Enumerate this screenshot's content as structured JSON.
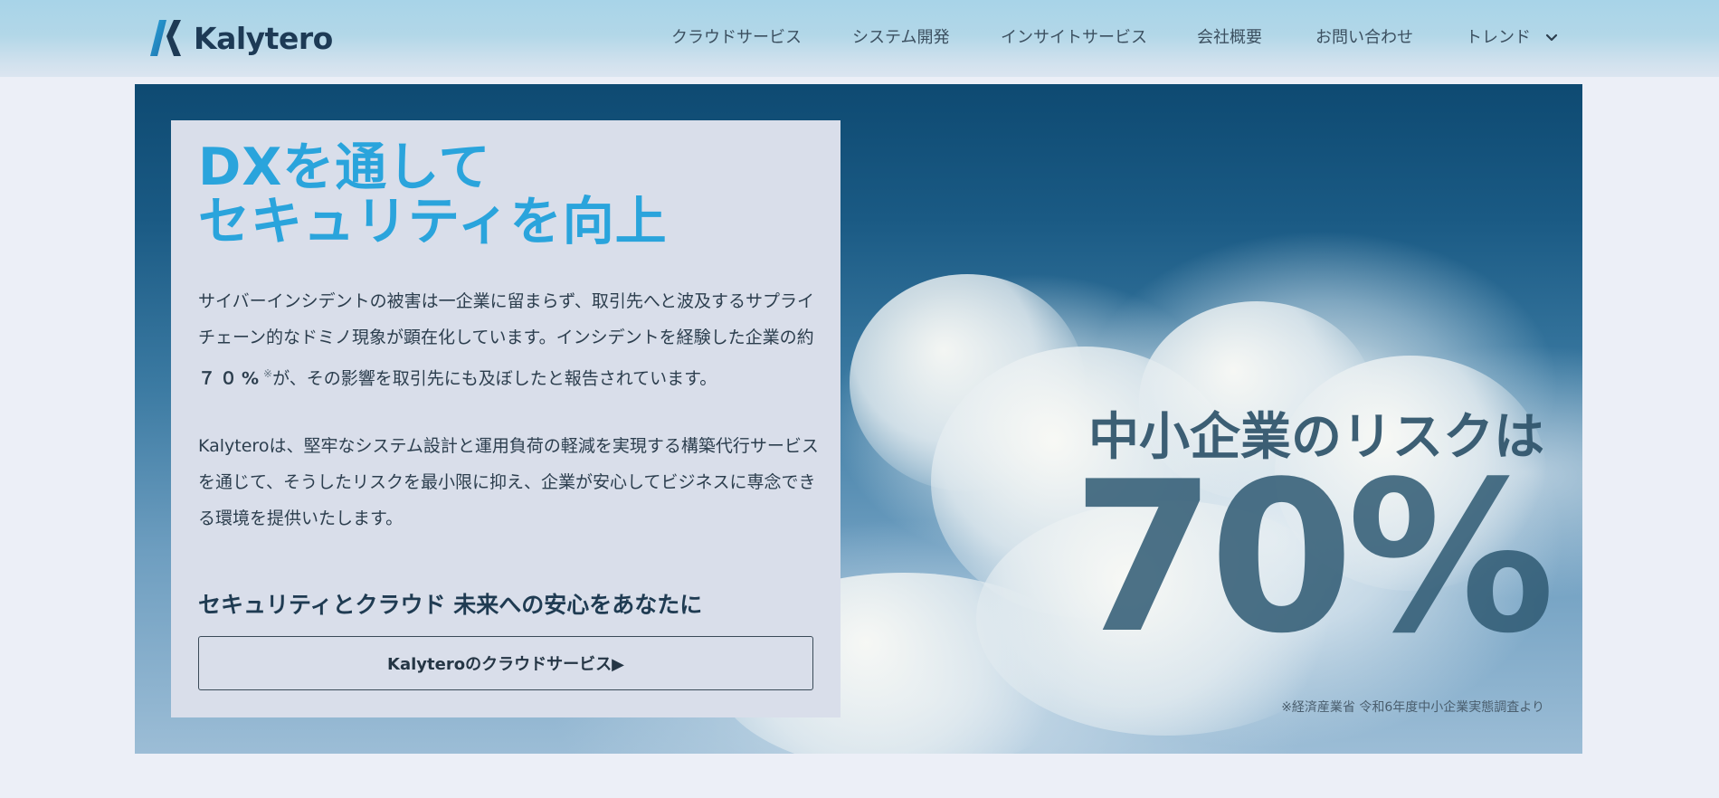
{
  "brand": {
    "name": "Kalytero",
    "accent": "#2aa4dc",
    "dark": "#1d3a55"
  },
  "nav": {
    "items": [
      {
        "label": "クラウドサービス"
      },
      {
        "label": "システム開発"
      },
      {
        "label": "インサイトサービス"
      },
      {
        "label": "会社概要"
      },
      {
        "label": "お問い合わせ"
      },
      {
        "label": "トレンド",
        "icon": "chevron-down-icon"
      }
    ]
  },
  "hero": {
    "title_line1": "DXを通して",
    "title_line2": "セキュリティを向上",
    "para1_text": "サイバーインシデントの被害は一企業に留まらず、取引先へと波及するサプライチェーン的なドミノ現象が顕在化しています。インシデントを経験した企業の約",
    "para1_highlight": "７０%",
    "para1_note": "※",
    "para1_rest": "が、その影響を取引先にも及ぼしたと報告されています。",
    "para2": "Kalyteroは、堅牢なシステム設計と運用負荷の軽減を実現する構築代行サービスを通じて、そうしたリスクを最小限に抑え、企業が安心してビジネスに専念できる環境を提供いたします。",
    "tagline": "セキュリティとクラウド 未来への安心をあなたに",
    "cta_label": "Kalyteroのクラウドサービス▶",
    "stat_label": "中小企業のリスクは",
    "stat_value": "70%",
    "stat_note": "※経済産業省 令和6年度中小企業実態調査より"
  }
}
